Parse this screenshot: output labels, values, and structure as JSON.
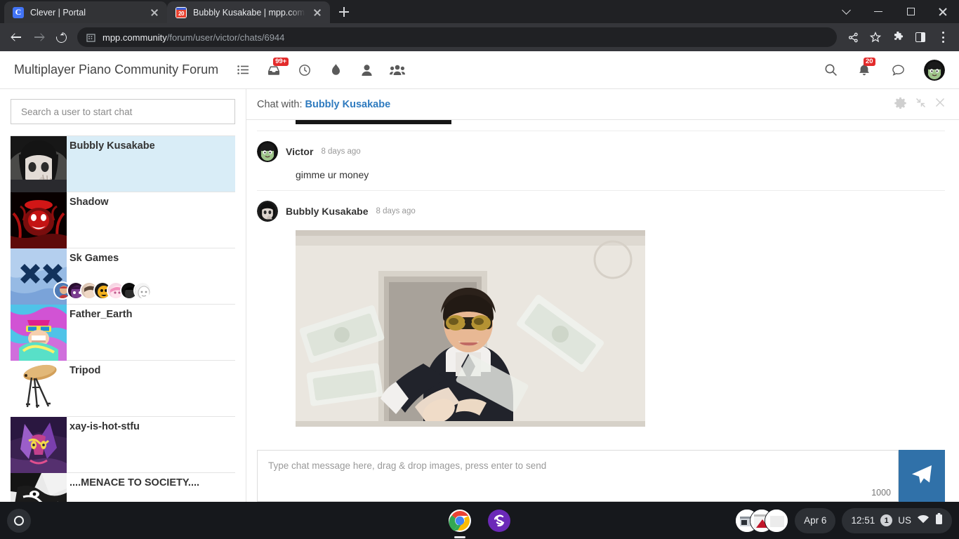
{
  "browser": {
    "tabs": [
      {
        "title": "Clever | Portal",
        "favicon": "clever-c-icon",
        "active": false
      },
      {
        "title": "Bubbly Kusakabe | mpp.commu",
        "favicon": "calendar-20-icon",
        "active": true
      }
    ],
    "newtab_label": "+",
    "omnibox": {
      "domain": "mpp.community",
      "path": "/forum/user/victor/chats/6944"
    },
    "toolbar_icons": [
      "back-arrow-icon",
      "forward-arrow-icon",
      "reload-icon",
      "site-info-icon",
      "share-icon",
      "bookmark-star-icon",
      "extensions-puzzle-icon",
      "side-panel-icon",
      "chrome-menu-icon"
    ],
    "window_controls": [
      "tab-search-icon",
      "minimize-icon",
      "maximize-icon",
      "close-icon"
    ]
  },
  "forum": {
    "title": "Multiplayer Piano Community Forum",
    "nav_left": [
      {
        "name": "categories-icon",
        "badge": ""
      },
      {
        "name": "inbox-icon",
        "badge": "99+"
      },
      {
        "name": "recent-clock-icon",
        "badge": ""
      },
      {
        "name": "popular-flame-icon",
        "badge": ""
      },
      {
        "name": "user-icon",
        "badge": ""
      },
      {
        "name": "groups-icon",
        "badge": ""
      }
    ],
    "nav_right": [
      {
        "name": "search-icon",
        "badge": ""
      },
      {
        "name": "notifications-bell-icon",
        "badge": "20"
      },
      {
        "name": "chat-bubble-icon",
        "badge": ""
      }
    ],
    "avatar_name": "user-avatar-victor"
  },
  "sidebar": {
    "search_placeholder": "Search a user to start chat",
    "chats": [
      {
        "name": "Bubbly Kusakabe",
        "active": true,
        "avatar": "avatar-bubbly-kusakabe",
        "members": []
      },
      {
        "name": "Shadow",
        "active": false,
        "avatar": "avatar-shadow",
        "members": []
      },
      {
        "name": "Sk Games",
        "active": false,
        "avatar": "avatar-sk-games",
        "members": [
          "m1",
          "m2",
          "m3",
          "m4",
          "m5",
          "m6",
          "m7"
        ]
      },
      {
        "name": "Father_Earth",
        "active": false,
        "avatar": "avatar-father-earth",
        "members": []
      },
      {
        "name": "Tripod",
        "active": false,
        "avatar": "avatar-tripod",
        "members": []
      },
      {
        "name": "xay-is-hot-stfu",
        "active": false,
        "avatar": "avatar-xay",
        "members": []
      },
      {
        "name": "....MENACE TO SOCIETY....",
        "active": false,
        "avatar": "avatar-menace",
        "members": []
      }
    ]
  },
  "conversation": {
    "header_prefix": "Chat with:",
    "header_name": "Bubbly Kusakabe",
    "tools": [
      "settings-gear-icon",
      "collapse-icon",
      "close-icon"
    ],
    "messages": [
      {
        "author": "Victor",
        "time": "8 days ago",
        "text": "gimme ur money",
        "has_image": false,
        "avatar": "avatar-victor"
      },
      {
        "author": "Bubbly Kusakabe",
        "time": "8 days ago",
        "text": "",
        "has_image": true,
        "image_alt": "man-in-suit-throwing-money-gif",
        "avatar": "avatar-bubbly-kusakabe"
      }
    ],
    "composer": {
      "placeholder": "Type chat message here, drag & drop images, press enter to send",
      "char_count": "1000",
      "send_icon": "send-paper-plane-icon"
    }
  },
  "shelf": {
    "launcher": "launcher-icon",
    "apps": [
      "chrome-icon",
      "purple-s-app-icon"
    ],
    "date": "Apr 6",
    "time": "12:51",
    "notification_count": "1",
    "keyboard_layout": "US",
    "status_icons": [
      "wifi-icon",
      "battery-icon"
    ]
  },
  "colors": {
    "accent_blue": "#3071a9",
    "link_blue": "#2f7bbf",
    "selected_row": "#d9edf7",
    "badge_red": "#e32b2b",
    "chrome_dark": "#35363a",
    "shelf_dark": "#16181c"
  }
}
